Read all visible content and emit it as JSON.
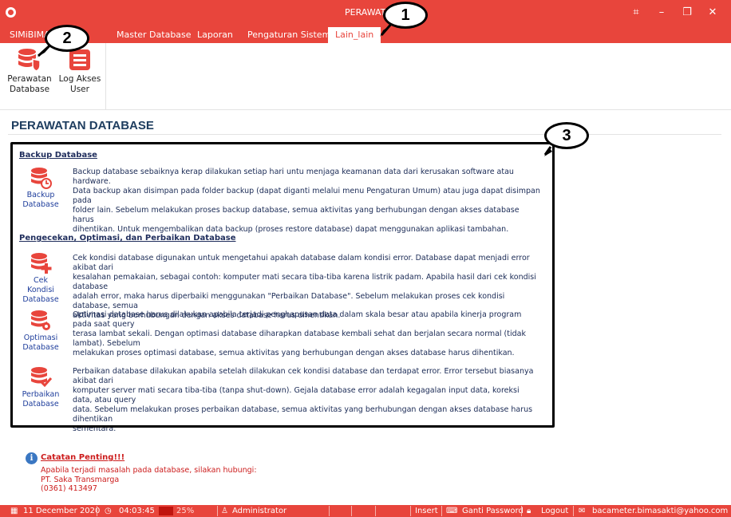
{
  "titlebar": {
    "title": "PERAWATAN"
  },
  "menu": {
    "tabs": [
      {
        "label": "SIMiBIMA"
      },
      {
        "label": "Master Database"
      },
      {
        "label": "Laporan"
      },
      {
        "label": "Pengaturan Sistem"
      },
      {
        "label": "Lain_lain"
      }
    ],
    "active_tab": "Lain_lain"
  },
  "ribbon": {
    "buttons": [
      {
        "label_line1": "Perawatan",
        "label_line2": "Database",
        "icon": "database-shield-icon"
      },
      {
        "label_line1": "Log Akses",
        "label_line2": "User",
        "icon": "log-list-icon"
      }
    ]
  },
  "page": {
    "title": "PERAWATAN DATABASE"
  },
  "sections": {
    "backup": {
      "heading": "Backup Database",
      "item": {
        "label_line1": "Backup",
        "label_line2": "Database",
        "icon": "database-backup-icon",
        "desc": [
          "Backup database sebaiknya kerap dilakukan setiap hari untu menjaga keamanan data dari kerusakan software atau hardware.",
          "Data backup akan disimpan pada folder backup (dapat diganti melalui menu Pengaturan Umum) atau juga dapat disimpan pada",
          "folder lain. Sebelum melakukan proses backup database, semua aktivitas yang berhubungan dengan akses database harus",
          "dihentikan. Untuk mengembalikan data backup (proses restore database) dapat menggunakan aplikasi tambahan."
        ]
      }
    },
    "maintenance": {
      "heading": "Pengecekan, Optimasi, dan Perbaikan Database",
      "items": [
        {
          "label_line1": "Cek Kondisi",
          "label_line2": "Database",
          "icon": "database-add-icon",
          "desc": [
            "Cek kondisi database digunakan untuk mengetahui apakah database dalam kondisi error. Database dapat menjadi error akibat dari",
            "kesalahan pemakaian, sebagai contoh: komputer mati secara tiba-tiba karena listrik padam. Apabila hasil dari cek kondisi database",
            "adalah error, maka harus diperbaiki menggunakan \"Perbaikan Database\".  Sebelum melakukan proses cek kondisi database, semua",
            "aktivitas yang berhubungan dengan akses database harus dihentikan."
          ]
        },
        {
          "label_line1": "Optimasi",
          "label_line2": "Database",
          "icon": "database-gear-icon",
          "desc": [
            "Optimasi database harus dilakukan apabila terjadi penghapusan data dalam skala besar atau apabila kinerja program pada saat query",
            "terasa lambat sekali. Dengan optimasi database diharapkan database kembali sehat dan berjalan secara normal (tidak lambat).  Sebelum",
            "melakukan proses optimasi database, semua aktivitas yang berhubungan dengan akses database harus dihentikan."
          ]
        },
        {
          "label_line1": "Perbaikan",
          "label_line2": "Database",
          "icon": "database-check-icon",
          "desc": [
            "Perbaikan database dilakukan apabila setelah dilakukan cek kondisi database dan terdapat error. Error tersebut biasanya akibat dari",
            "komputer server mati secara tiba-tiba (tanpa shut-down). Gejala database error adalah kegagalan input data, koreksi data, atau query",
            "data. Sebelum melakukan proses perbaikan database, semua aktivitas yang berhubungan dengan akses database harus dihentikan",
            "sementara."
          ]
        }
      ]
    }
  },
  "annotations": {
    "callout1": "1",
    "callout2": "2",
    "callout3": "3"
  },
  "note": {
    "title": "Catatan Penting!!!",
    "lines": [
      "Apabila terjadi masalah pada database, silakan hubungi:",
      "PT. Saka Transmarga",
      "(0361) 413497"
    ]
  },
  "statusbar": {
    "date": "11 December 2020",
    "time": "04:03:45",
    "progress_text": "25%",
    "progress_fraction": 0.25,
    "user": "Administrator",
    "mode": "Insert",
    "change_password": "Ganti Password",
    "logout": "Logout",
    "email": "bacameter.bimasakti@yahoo.com"
  },
  "colors": {
    "accent": "#e8453c",
    "heading": "#1f3e60",
    "link": "#cc1c1c"
  }
}
